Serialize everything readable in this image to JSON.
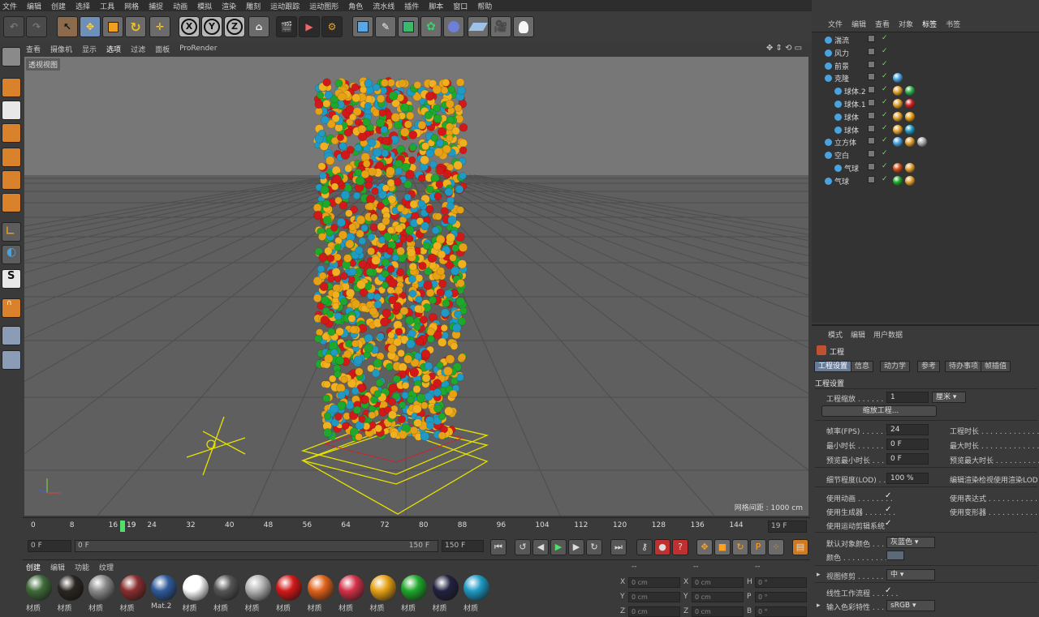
{
  "menu": [
    "文件",
    "编辑",
    "创建",
    "选择",
    "工具",
    "网格",
    "捕捉",
    "动画",
    "模拟",
    "渲染",
    "雕刻",
    "运动跟踪",
    "运动图形",
    "角色",
    "流水线",
    "插件",
    "脚本",
    "窗口",
    "帮助"
  ],
  "toolbar": {
    "x": "X",
    "y": "Y",
    "z": "Z"
  },
  "viewport_menu": [
    "查看",
    "摄像机",
    "显示",
    "选项",
    "过滤",
    "面板",
    "ProRender"
  ],
  "viewport": {
    "label": "透视视图",
    "grid_info": "网格间距 : 1000 cm"
  },
  "timeline": {
    "ticks": [
      "0",
      "8",
      "16",
      "24",
      "32",
      "40",
      "48",
      "56",
      "64",
      "72",
      "80",
      "88",
      "96",
      "104",
      "112",
      "120",
      "128",
      "136",
      "144"
    ],
    "current_frame": "19",
    "current_frame_field": "19 F",
    "start_field": "0 F",
    "range_start": "0 F",
    "range_end": "150 F",
    "end_field": "150 F"
  },
  "material_menu": [
    "创建",
    "编辑",
    "功能",
    "纹理"
  ],
  "materials": [
    {
      "label": "材质",
      "color": "#3f6b3a"
    },
    {
      "label": "材质",
      "color": "#2a2520"
    },
    {
      "label": "材质",
      "color": "#8a8a8a"
    },
    {
      "label": "材质",
      "color": "#8a2e2e"
    },
    {
      "label": "Mat.2",
      "color": "#2f5b9a"
    },
    {
      "label": "材质",
      "color": "#ffffff"
    },
    {
      "label": "材质",
      "color": "#555555"
    },
    {
      "label": "材质",
      "color": "#b5b5b5"
    },
    {
      "label": "材质",
      "color": "#d21818"
    },
    {
      "label": "材质",
      "color": "#e0621a"
    },
    {
      "label": "材质",
      "color": "#d43148"
    },
    {
      "label": "材质",
      "color": "#e6a114"
    },
    {
      "label": "材质",
      "color": "#1fa82b"
    },
    {
      "label": "材质",
      "color": "#222240"
    },
    {
      "label": "材质",
      "color": "#1f9ac4"
    }
  ],
  "coords": {
    "headers": [
      "--",
      "--",
      "--"
    ],
    "rows": [
      {
        "a": "X",
        "av": "0 cm",
        "b": "X",
        "bv": "0 cm",
        "c": "H",
        "cv": "0 °"
      },
      {
        "a": "Y",
        "av": "0 cm",
        "b": "Y",
        "bv": "0 cm",
        "c": "P",
        "cv": "0 °"
      },
      {
        "a": "Z",
        "av": "0 cm",
        "b": "Z",
        "bv": "0 cm",
        "c": "B",
        "cv": "0 °"
      }
    ]
  },
  "object_menu": [
    "文件",
    "编辑",
    "查看",
    "对象",
    "标签",
    "书签"
  ],
  "objects": [
    {
      "name": "湍流",
      "indent": 0
    },
    {
      "name": "风力",
      "indent": 0
    },
    {
      "name": "前景",
      "indent": 0
    },
    {
      "name": "克隆",
      "indent": 0
    },
    {
      "name": "球体.2",
      "indent": 1
    },
    {
      "name": "球体.1",
      "indent": 1
    },
    {
      "name": "球体",
      "indent": 1
    },
    {
      "name": "球体",
      "indent": 1
    },
    {
      "name": "立方体",
      "indent": 0
    },
    {
      "name": "空白",
      "indent": 0
    },
    {
      "name": "气球",
      "indent": 1
    },
    {
      "name": "气球",
      "indent": 0
    }
  ],
  "attr": {
    "menu": [
      "模式",
      "编辑",
      "用户数据"
    ],
    "title": "工程",
    "tabs": [
      "工程设置",
      "信息",
      "动力学",
      "参考",
      "待办事项",
      "帧插值"
    ],
    "section": "工程设置",
    "scale_label": "工程缩放 . . . . . . . . .",
    "scale_value": "1",
    "scale_unit": "厘米",
    "scale_button": "缩放工程...",
    "fps_label": "帧率(FPS) . . . . . . .",
    "fps_value": "24",
    "project_time_label": "工程时长 . . . . . . . . . . . . . .",
    "min_time_label": "最小时长 . . . . . . . .",
    "min_time_value": "0 F",
    "max_time_label": "最大时长 . . . . . . . . . . . . . .",
    "preview_min_label": "预览最小时长 . . .",
    "preview_min_value": "0 F",
    "preview_max_label": "预览最大时长 . . . . . . . . . . .",
    "lod_label": "细节程度(LOD) . . . .",
    "lod_value": "100 %",
    "lod_right": "编辑渲染检视使用渲染LOD级别",
    "use_anim": "使用动画 . . . . . . . .",
    "use_expr": "使用表达式 . . . . . . . . . . . .",
    "use_gen": "使用生成器 . . . . . . .",
    "use_deform": "使用变形器 . . . . . . . . . . . .",
    "use_motion": "使用运动剪辑系统",
    "default_color_label": "默认对象颜色 . . . .",
    "default_color_value": "灰蓝色",
    "color_label": "颜色 . . . . . . . . . . . . .",
    "view_clip_label": "视图修剪 . . . . . . . . .",
    "view_clip_value": "中",
    "linear_label": "线性工作流程 . . . . . .",
    "input_color_label": "输入色彩特性 . . . .",
    "input_color_value": "sRGB",
    "check": "✓"
  }
}
